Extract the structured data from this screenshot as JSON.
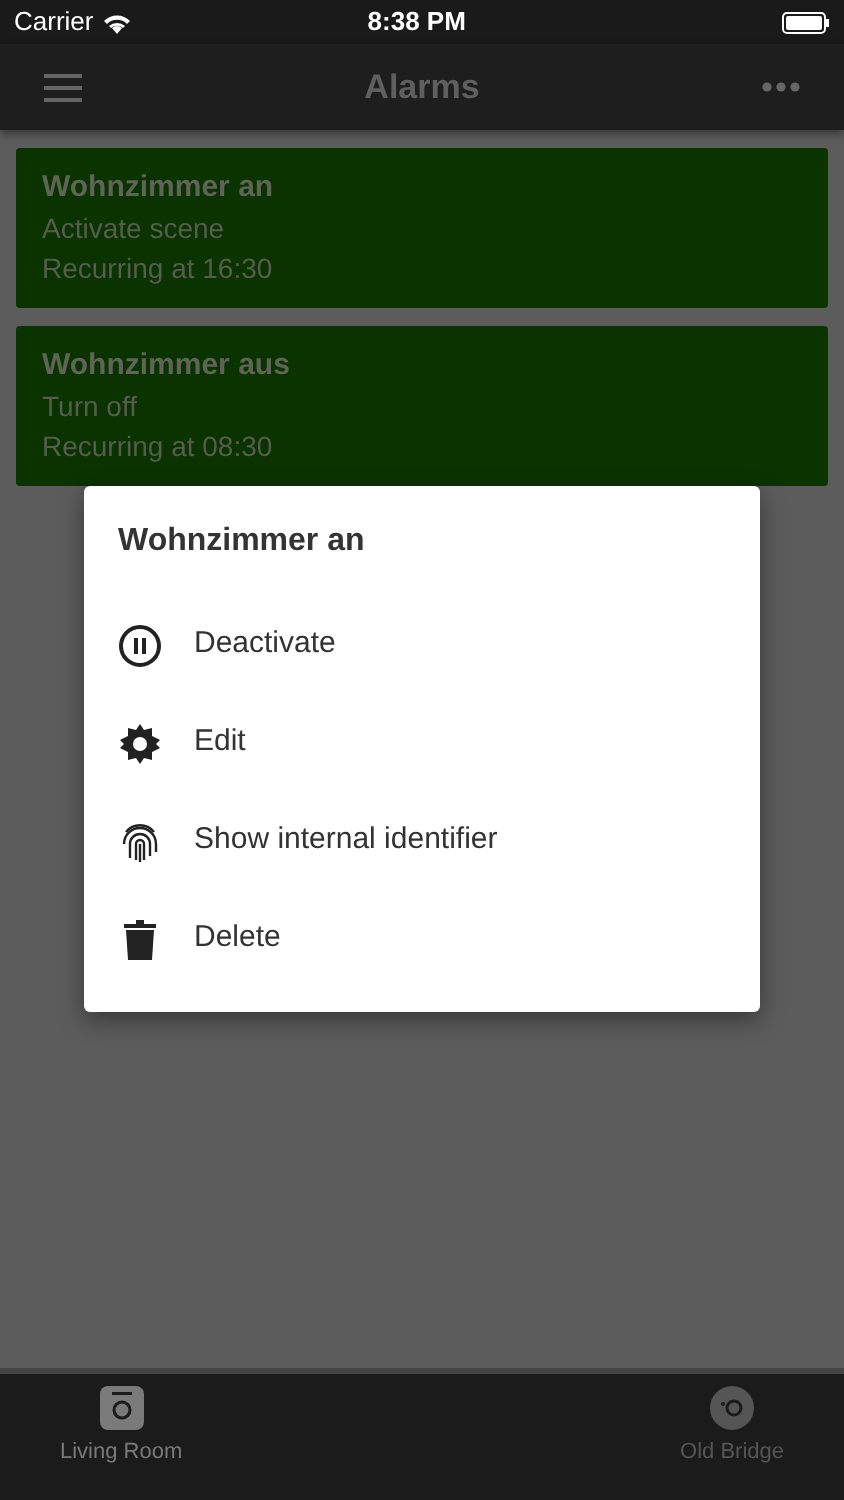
{
  "status_bar": {
    "carrier": "Carrier",
    "time": "8:38 PM"
  },
  "navbar": {
    "title": "Alarms"
  },
  "alarms": [
    {
      "name": "Wohnzimmer an",
      "action": "Activate scene",
      "schedule": "Recurring at 16:30"
    },
    {
      "name": "Wohnzimmer aus",
      "action": "Turn off",
      "schedule": "Recurring at 08:30"
    }
  ],
  "dialog": {
    "title": "Wohnzimmer an",
    "items": [
      {
        "kind": "pause",
        "label": "Deactivate"
      },
      {
        "kind": "gear",
        "label": "Edit"
      },
      {
        "kind": "fingerprint",
        "label": "Show internal identifier"
      },
      {
        "kind": "trash",
        "label": "Delete"
      }
    ]
  },
  "tabs": [
    {
      "label": "Living Room",
      "selected": true
    },
    {
      "label": "Old Bridge",
      "selected": false
    }
  ]
}
